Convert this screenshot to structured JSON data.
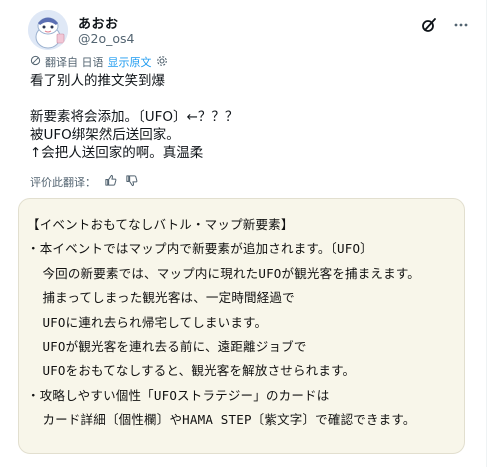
{
  "user": {
    "name": "あおお",
    "handle": "@2o_os4"
  },
  "translation": {
    "label": "翻译自 日语",
    "show_original": "显示原文"
  },
  "tweet": {
    "lines": [
      "看了别人的推文笑到爆",
      "",
      "新要素将会添加。〔UFO〕←？？？",
      "被UFO绑架然后送回家。",
      "↑会把人送回家的啊。真温柔"
    ]
  },
  "rating": {
    "label": "评价此翻译："
  },
  "card": {
    "lines": [
      "【イベントおもてなしバトル・マップ新要素】",
      "・本イベントではマップ内で新要素が追加されます。〔UFO〕",
      "  今回の新要素では、マップ内に現れたUFOが観光客を捕まえます。",
      "  捕まってしまった観光客は、一定時間経過で",
      "  UFOに連れ去られ帰宅してしまいます。",
      "  UFOが観光客を連れ去る前に、遠距離ジョブで",
      "  UFOをおもてなしすると、観光客を解放させられます。",
      "・攻略しやすい個性「UFOストラテジー」のカードは",
      "  カード詳細〔個性欄〕やHAMA STEP〔紫文字〕で確認できます。"
    ]
  },
  "icons": {
    "avatar": "avatar-illustration",
    "grok": "grok-icon",
    "more": "more-icon",
    "translate": "translate-icon",
    "settings": "settings-icon",
    "thumbs_up": "thumbs-up-icon",
    "thumbs_down": "thumbs-down-icon"
  },
  "colors": {
    "link": "#1d9bf0",
    "secondary_text": "#536471",
    "card_background": "#f8f6ea"
  }
}
